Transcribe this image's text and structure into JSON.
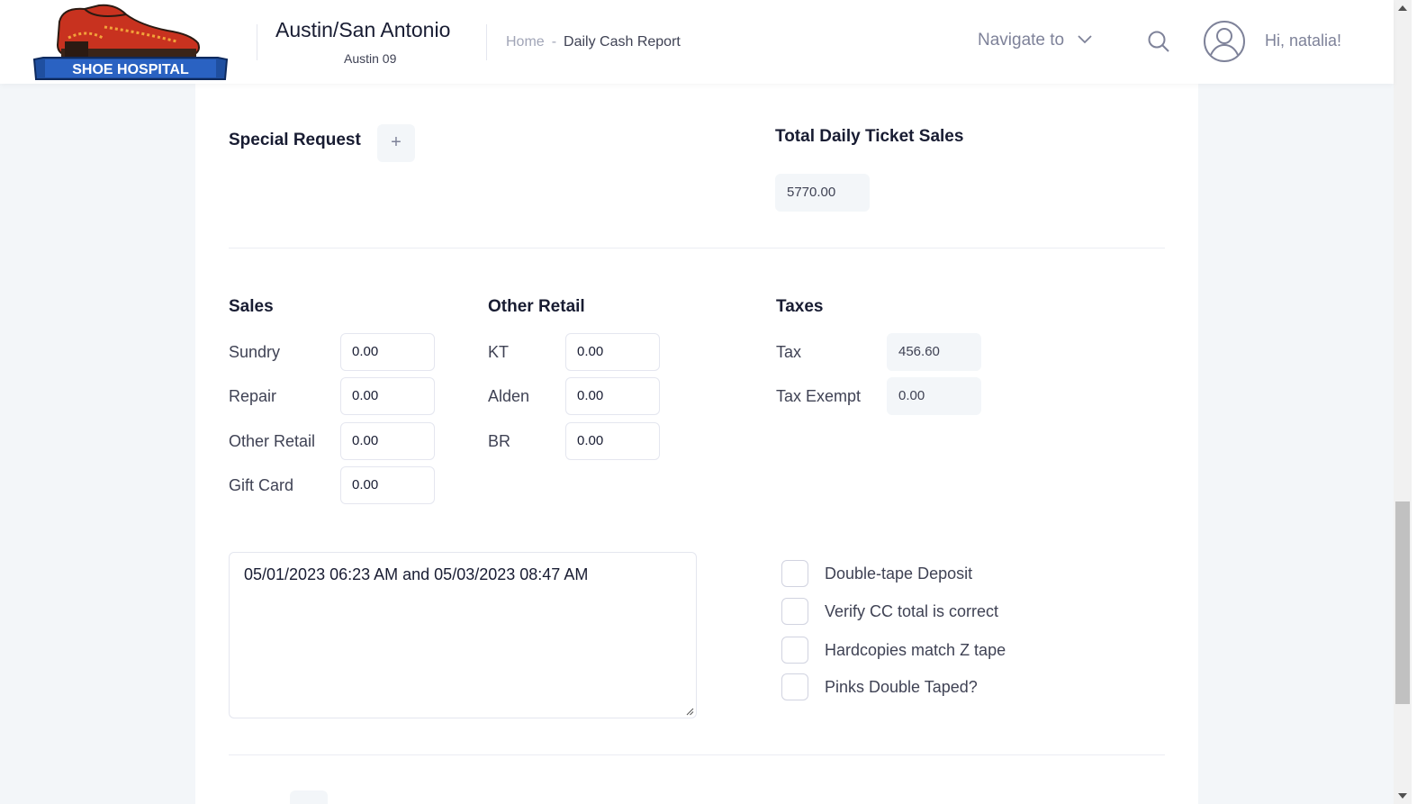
{
  "header": {
    "logo_text": "SHOE HOSPITAL",
    "store_name": "Austin/San Antonio",
    "store_sub": "Austin 09",
    "breadcrumb": {
      "home": "Home",
      "separator": "-",
      "current": "Daily Cash Report"
    },
    "navigate_label": "Navigate to",
    "greeting": "Hi, natalia!",
    "icons": {
      "search": "search-icon",
      "avatar": "user-avatar-icon",
      "dropdown": "chevron-down-icon"
    }
  },
  "special_request": {
    "label": "Special Request",
    "add_symbol": "+"
  },
  "total_sales": {
    "label": "Total Daily Ticket Sales",
    "value": "5770.00"
  },
  "sales": {
    "title": "Sales",
    "rows": [
      {
        "label": "Sundry",
        "value": "0.00"
      },
      {
        "label": "Repair",
        "value": "0.00"
      },
      {
        "label": "Other Retail",
        "value": "0.00"
      },
      {
        "label": "Gift Card",
        "value": "0.00"
      }
    ]
  },
  "other_retail": {
    "title": "Other Retail",
    "rows": [
      {
        "label": "KT",
        "value": "0.00"
      },
      {
        "label": "Alden",
        "value": "0.00"
      },
      {
        "label": "BR",
        "value": "0.00"
      }
    ]
  },
  "taxes": {
    "title": "Taxes",
    "rows": [
      {
        "label": "Tax",
        "value": "456.60"
      },
      {
        "label": "Tax Exempt",
        "value": "0.00"
      }
    ]
  },
  "notes": {
    "text": "05/01/2023 06:23 AM and 05/03/2023 08:47 AM"
  },
  "checklist": [
    {
      "label": "Double-tape Deposit",
      "checked": false
    },
    {
      "label": "Verify CC total is correct",
      "checked": false
    },
    {
      "label": "Hardcopies match Z tape",
      "checked": false
    },
    {
      "label": "Pinks Double Taped?",
      "checked": false
    }
  ],
  "colors": {
    "accent_text": "#181c32",
    "muted": "#7e8299",
    "page_bg": "#f3f6f9",
    "logo_red": "#c8321f",
    "logo_blue": "#1f4fa0"
  }
}
